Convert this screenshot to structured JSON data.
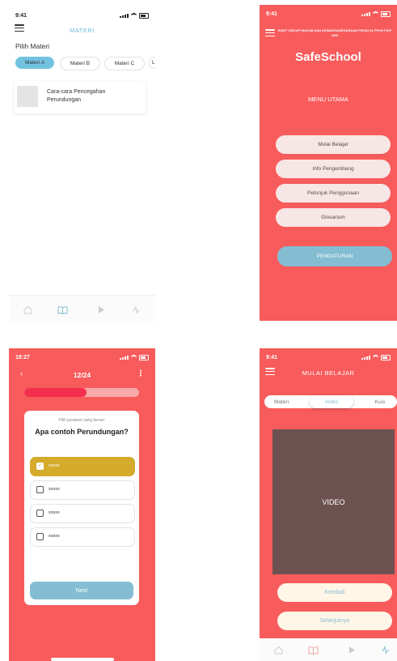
{
  "screen_materi": {
    "status_time": "9:41",
    "title": "MATERI",
    "section_label": "Pilih Materi",
    "chips": [
      "Materi A",
      "Materi B",
      "Materi C",
      "L"
    ],
    "active_chip": "Materi A",
    "lesson_card_title": "Cara-cara Pencegahan Perundungan",
    "nav_icons": [
      "home-icon",
      "book-icon",
      "play-icon",
      "activity-icon"
    ]
  },
  "screen_menu": {
    "status_time": "9:41",
    "header_text": "RISET GROUP HUKUM DAN KEWARGANEGARAAN PRODI S1 PPKN FKIP UNS",
    "app_name": "SafeSchool",
    "menu_title": "MENU UTAMA",
    "menu_items": [
      "Mulai Belajar",
      "Info Pengembang",
      "Petunjuk Penggunaan",
      "Glosarium"
    ],
    "settings_label": "PENGATURAN"
  },
  "screen_quiz": {
    "status_time": "19:27",
    "counter": "12/24",
    "progress": 0.54,
    "hint": "Pilih jawaban yang benar!",
    "question": "Apa contoh Perundungan?",
    "options": [
      "xxxxx",
      "xxxxx",
      "xxxxx",
      "xxxxx"
    ],
    "selected_index": 0,
    "next_label": "Next"
  },
  "screen_video": {
    "status_time": "9:41",
    "title": "MULAI BELAJAR",
    "tabs": [
      "Materi",
      "Video",
      "Kuis"
    ],
    "active_tab": "Video",
    "video_label": "VIDEO",
    "back_label": "Kembali",
    "next_label": "Selanjutnya"
  },
  "colors": {
    "primary_red": "#f85b5b",
    "accent_blue": "#84bdd2",
    "selected_gold": "#d4ab2a",
    "video_bg": "#6c5150"
  }
}
